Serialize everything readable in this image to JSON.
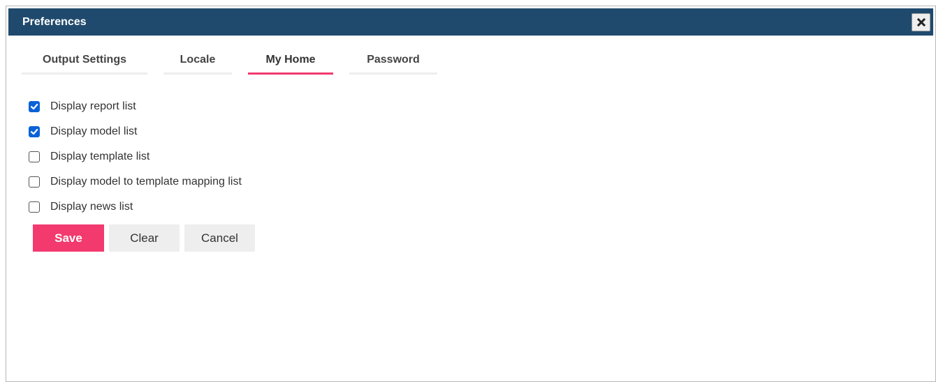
{
  "dialog": {
    "title": "Preferences",
    "close_icon": "close-x-icon"
  },
  "tabs": [
    {
      "label": "Output Settings",
      "active": false
    },
    {
      "label": "Locale",
      "active": false
    },
    {
      "label": "My Home",
      "active": true
    },
    {
      "label": "Password",
      "active": false
    }
  ],
  "options": [
    {
      "label": "Display report list",
      "checked": true
    },
    {
      "label": "Display model list",
      "checked": true
    },
    {
      "label": "Display template list",
      "checked": false
    },
    {
      "label": "Display model to template mapping list",
      "checked": false
    },
    {
      "label": "Display news list",
      "checked": false
    }
  ],
  "buttons": {
    "save": "Save",
    "clear": "Clear",
    "cancel": "Cancel"
  },
  "colors": {
    "titlebar": "#204a6d",
    "accent": "#f23a6e",
    "checkbox_checked": "#0a62d9",
    "button_gray": "#eeeeee"
  }
}
